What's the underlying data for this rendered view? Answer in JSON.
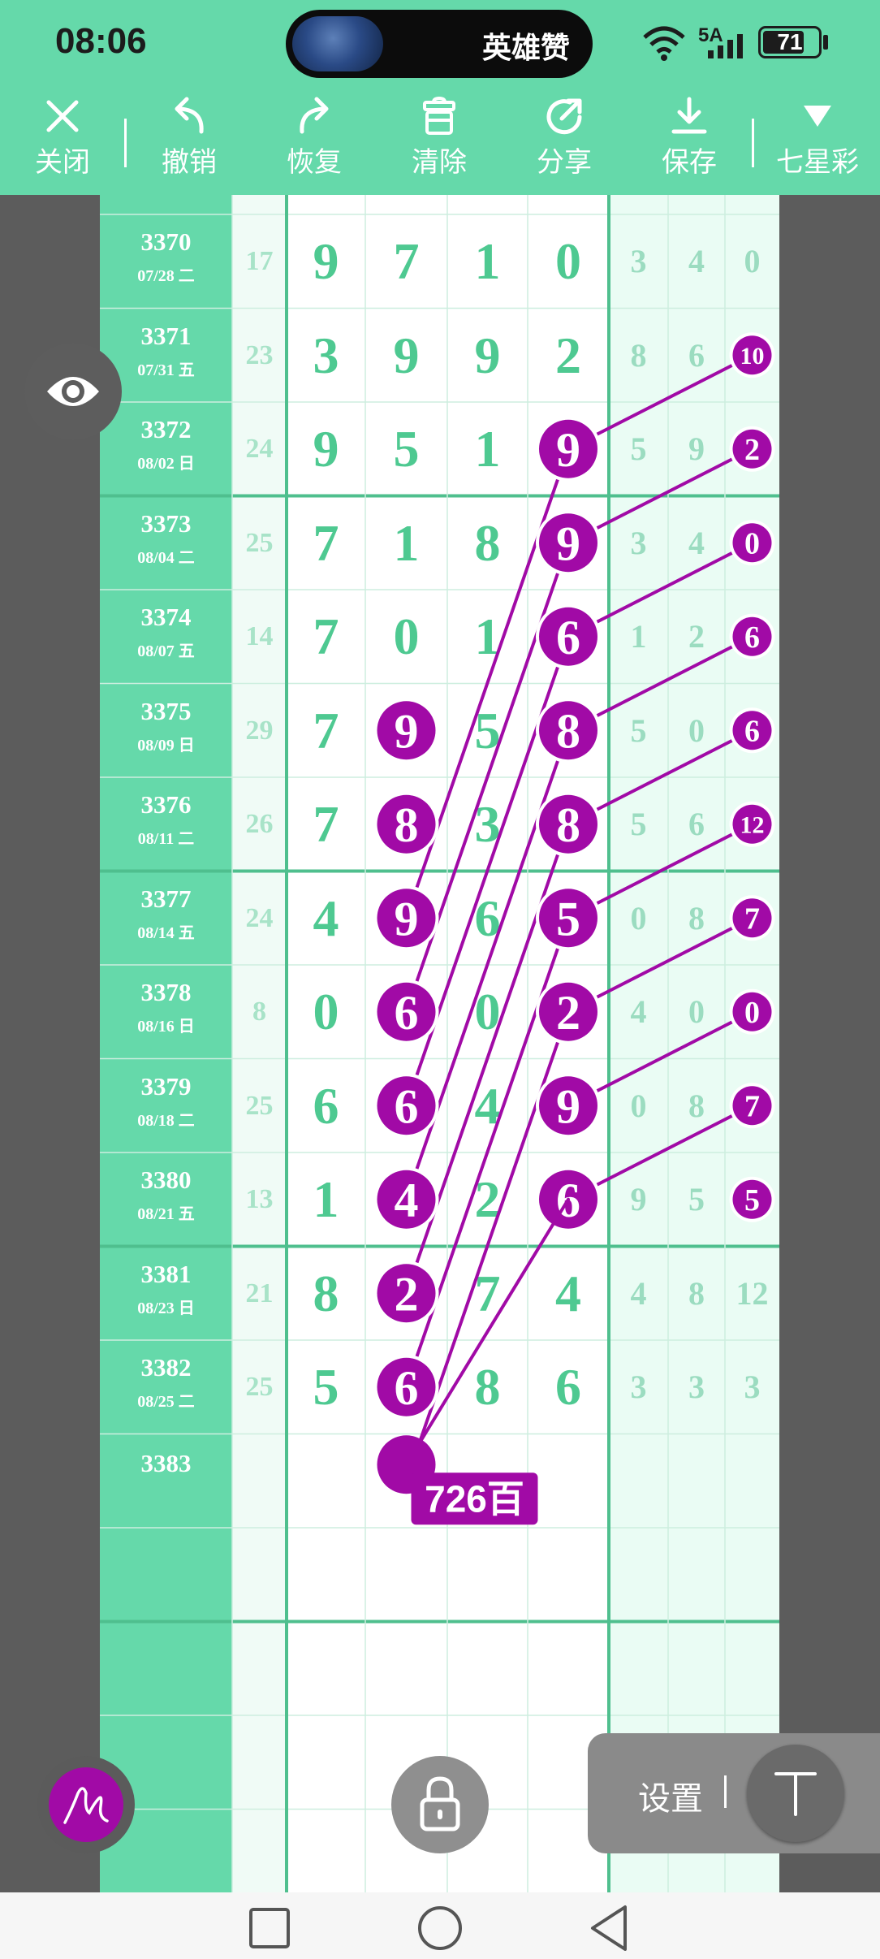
{
  "status_bar": {
    "time": "08:06",
    "now_playing": "英雄赞",
    "network": "5A",
    "battery": "71"
  },
  "toolbar": {
    "close": "关闭",
    "undo": "撤销",
    "redo": "恢复",
    "clear": "清除",
    "share": "分享",
    "save": "保存",
    "lottery": "七星彩"
  },
  "rows": [
    {
      "issue": "3370",
      "date": "07/28 二",
      "sum": "17",
      "d": [
        "9",
        "7",
        "1",
        "0"
      ],
      "t": [
        "3",
        "4",
        "0"
      ]
    },
    {
      "issue": "3371",
      "date": "07/31 五",
      "sum": "23",
      "d": [
        "3",
        "9",
        "9",
        "2"
      ],
      "t": [
        "8",
        "6",
        "10"
      ]
    },
    {
      "issue": "3372",
      "date": "08/02 日",
      "sum": "24",
      "d": [
        "9",
        "5",
        "1",
        "9"
      ],
      "t": [
        "5",
        "9",
        "2"
      ]
    },
    {
      "issue": "3373",
      "date": "08/04 二",
      "sum": "25",
      "d": [
        "7",
        "1",
        "8",
        "9"
      ],
      "t": [
        "3",
        "4",
        "0"
      ]
    },
    {
      "issue": "3374",
      "date": "08/07 五",
      "sum": "14",
      "d": [
        "7",
        "0",
        "1",
        "6"
      ],
      "t": [
        "1",
        "2",
        "6"
      ]
    },
    {
      "issue": "3375",
      "date": "08/09 日",
      "sum": "29",
      "d": [
        "7",
        "9",
        "5",
        "8"
      ],
      "t": [
        "5",
        "0",
        "6"
      ]
    },
    {
      "issue": "3376",
      "date": "08/11 二",
      "sum": "26",
      "d": [
        "7",
        "8",
        "3",
        "8"
      ],
      "t": [
        "5",
        "6",
        "12"
      ]
    },
    {
      "issue": "3377",
      "date": "08/14 五",
      "sum": "24",
      "d": [
        "4",
        "9",
        "6",
        "5"
      ],
      "t": [
        "0",
        "8",
        "7"
      ]
    },
    {
      "issue": "3378",
      "date": "08/16 日",
      "sum": "8",
      "d": [
        "0",
        "6",
        "0",
        "2"
      ],
      "t": [
        "4",
        "0",
        "0"
      ]
    },
    {
      "issue": "3379",
      "date": "08/18 二",
      "sum": "25",
      "d": [
        "6",
        "6",
        "4",
        "9"
      ],
      "t": [
        "0",
        "8",
        "7"
      ]
    },
    {
      "issue": "3380",
      "date": "08/21 五",
      "sum": "13",
      "d": [
        "1",
        "4",
        "2",
        "6"
      ],
      "t": [
        "9",
        "5",
        "5"
      ]
    },
    {
      "issue": "3381",
      "date": "08/23 日",
      "sum": "21",
      "d": [
        "8",
        "2",
        "7",
        "4"
      ],
      "t": [
        "4",
        "8",
        "12"
      ]
    },
    {
      "issue": "3382",
      "date": "08/25 二",
      "sum": "25",
      "d": [
        "5",
        "6",
        "8",
        "6"
      ],
      "t": [
        "3",
        "3",
        "3"
      ]
    },
    {
      "issue": "3383",
      "date": "",
      "sum": "",
      "d": [
        "",
        "",
        "",
        ""
      ],
      "t": [
        "",
        "",
        ""
      ]
    }
  ],
  "marks": {
    "col2_rows": [
      5,
      6,
      7,
      8,
      9,
      10,
      11,
      12
    ],
    "col4_rows": [
      2,
      3,
      4,
      5,
      6,
      7,
      8,
      9,
      10
    ],
    "col7_rows": [
      1,
      2,
      3,
      4,
      5,
      6,
      7,
      8,
      9,
      10
    ],
    "color": "#a10aa6"
  },
  "prediction": {
    "label": "726百"
  },
  "settings": {
    "label": "设置"
  },
  "colors": {
    "accent": "#65d9aa",
    "digit": "#4ec991",
    "mark": "#a10aa6"
  },
  "icons": [
    "close-icon",
    "undo-icon",
    "redo-icon",
    "clear-icon",
    "share-icon",
    "save-icon",
    "triangle-down-icon",
    "eye-icon",
    "pen-icon",
    "lock-icon",
    "t-icon",
    "nav-square-icon",
    "nav-circle-icon",
    "nav-back-icon"
  ]
}
